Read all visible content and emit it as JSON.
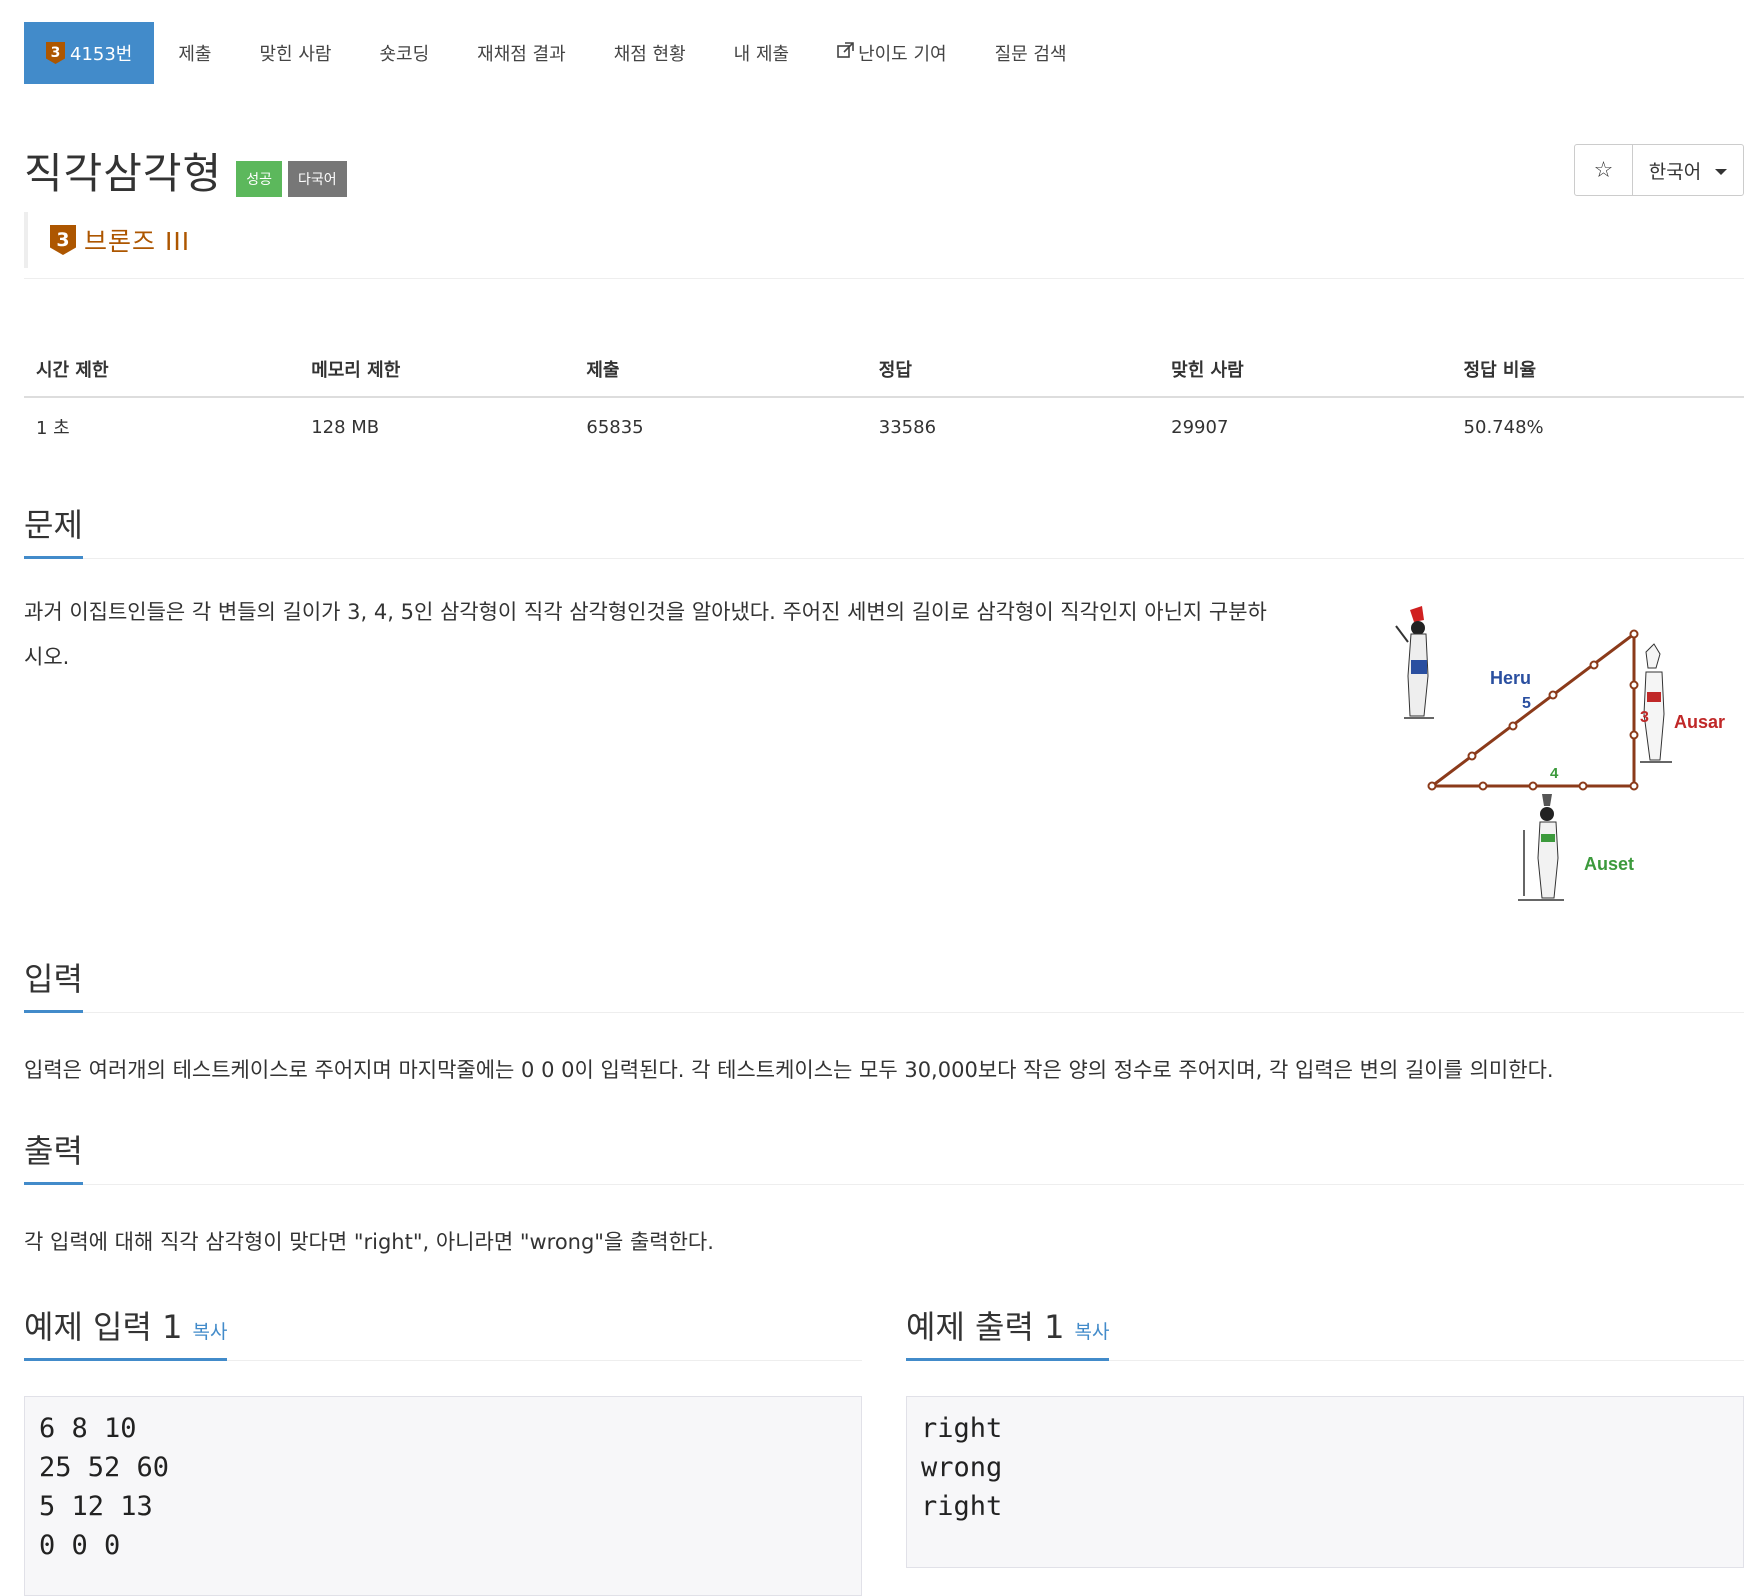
{
  "nav": {
    "problem_tab": {
      "tier_number": "3",
      "label": "4153번"
    },
    "tabs": [
      "제출",
      "맞힌 사람",
      "숏코딩",
      "재채점 결과",
      "채점 현황",
      "내 제출",
      "난이도 기여",
      "질문 검색"
    ]
  },
  "problem": {
    "title": "직각삼각형",
    "labels": {
      "success": "성공",
      "multilang": "다국어"
    },
    "tier": {
      "number": "3",
      "name": "브론즈 III"
    },
    "star_icon": "☆",
    "language": "한국어"
  },
  "stats": {
    "headers": [
      "시간 제한",
      "메모리 제한",
      "제출",
      "정답",
      "맞힌 사람",
      "정답 비율"
    ],
    "values": [
      "1 초",
      "128 MB",
      "65835",
      "33586",
      "29907",
      "50.748%"
    ]
  },
  "sections": {
    "description": {
      "title": "문제",
      "line1": "과거 이집트인들은 각 변들의 길이가 3, 4, 5인 삼각형이 직각 삼각형인것을 알아냈다. 주어진 세변의 길이로 삼각형이 직각인지 아닌지 구분하",
      "line2": "시오."
    },
    "input": {
      "title": "입력",
      "text": "입력은 여러개의 테스트케이스로 주어지며 마지막줄에는 0 0 0이 입력된다. 각 테스트케이스는 모두 30,000보다 작은 양의 정수로 주어지며, 각 입력은 변의 길이를 의미한다."
    },
    "output": {
      "title": "출력",
      "text": "각 입력에 대해 직각 삼각형이 맞다면 \"right\", 아니라면 \"wrong\"을 출력한다."
    }
  },
  "figure": {
    "labels": {
      "heru": "Heru",
      "ausar": "Ausar",
      "auset": "Auset",
      "side_5": "5",
      "side_3": "3",
      "side_4": "4"
    }
  },
  "samples": {
    "input": {
      "title": "예제 입력 1",
      "copy": "복사",
      "content": "6 8 10\n25 52 60\n5 12 13\n0 0 0"
    },
    "output": {
      "title": "예제 출력 1",
      "copy": "복사",
      "content": "right\nwrong\nright"
    }
  },
  "colors": {
    "primary": "#428bca",
    "success": "#5cb85c",
    "multilang": "#777777",
    "bronze": "#ad5600",
    "triangle": "#8b3a1a"
  }
}
